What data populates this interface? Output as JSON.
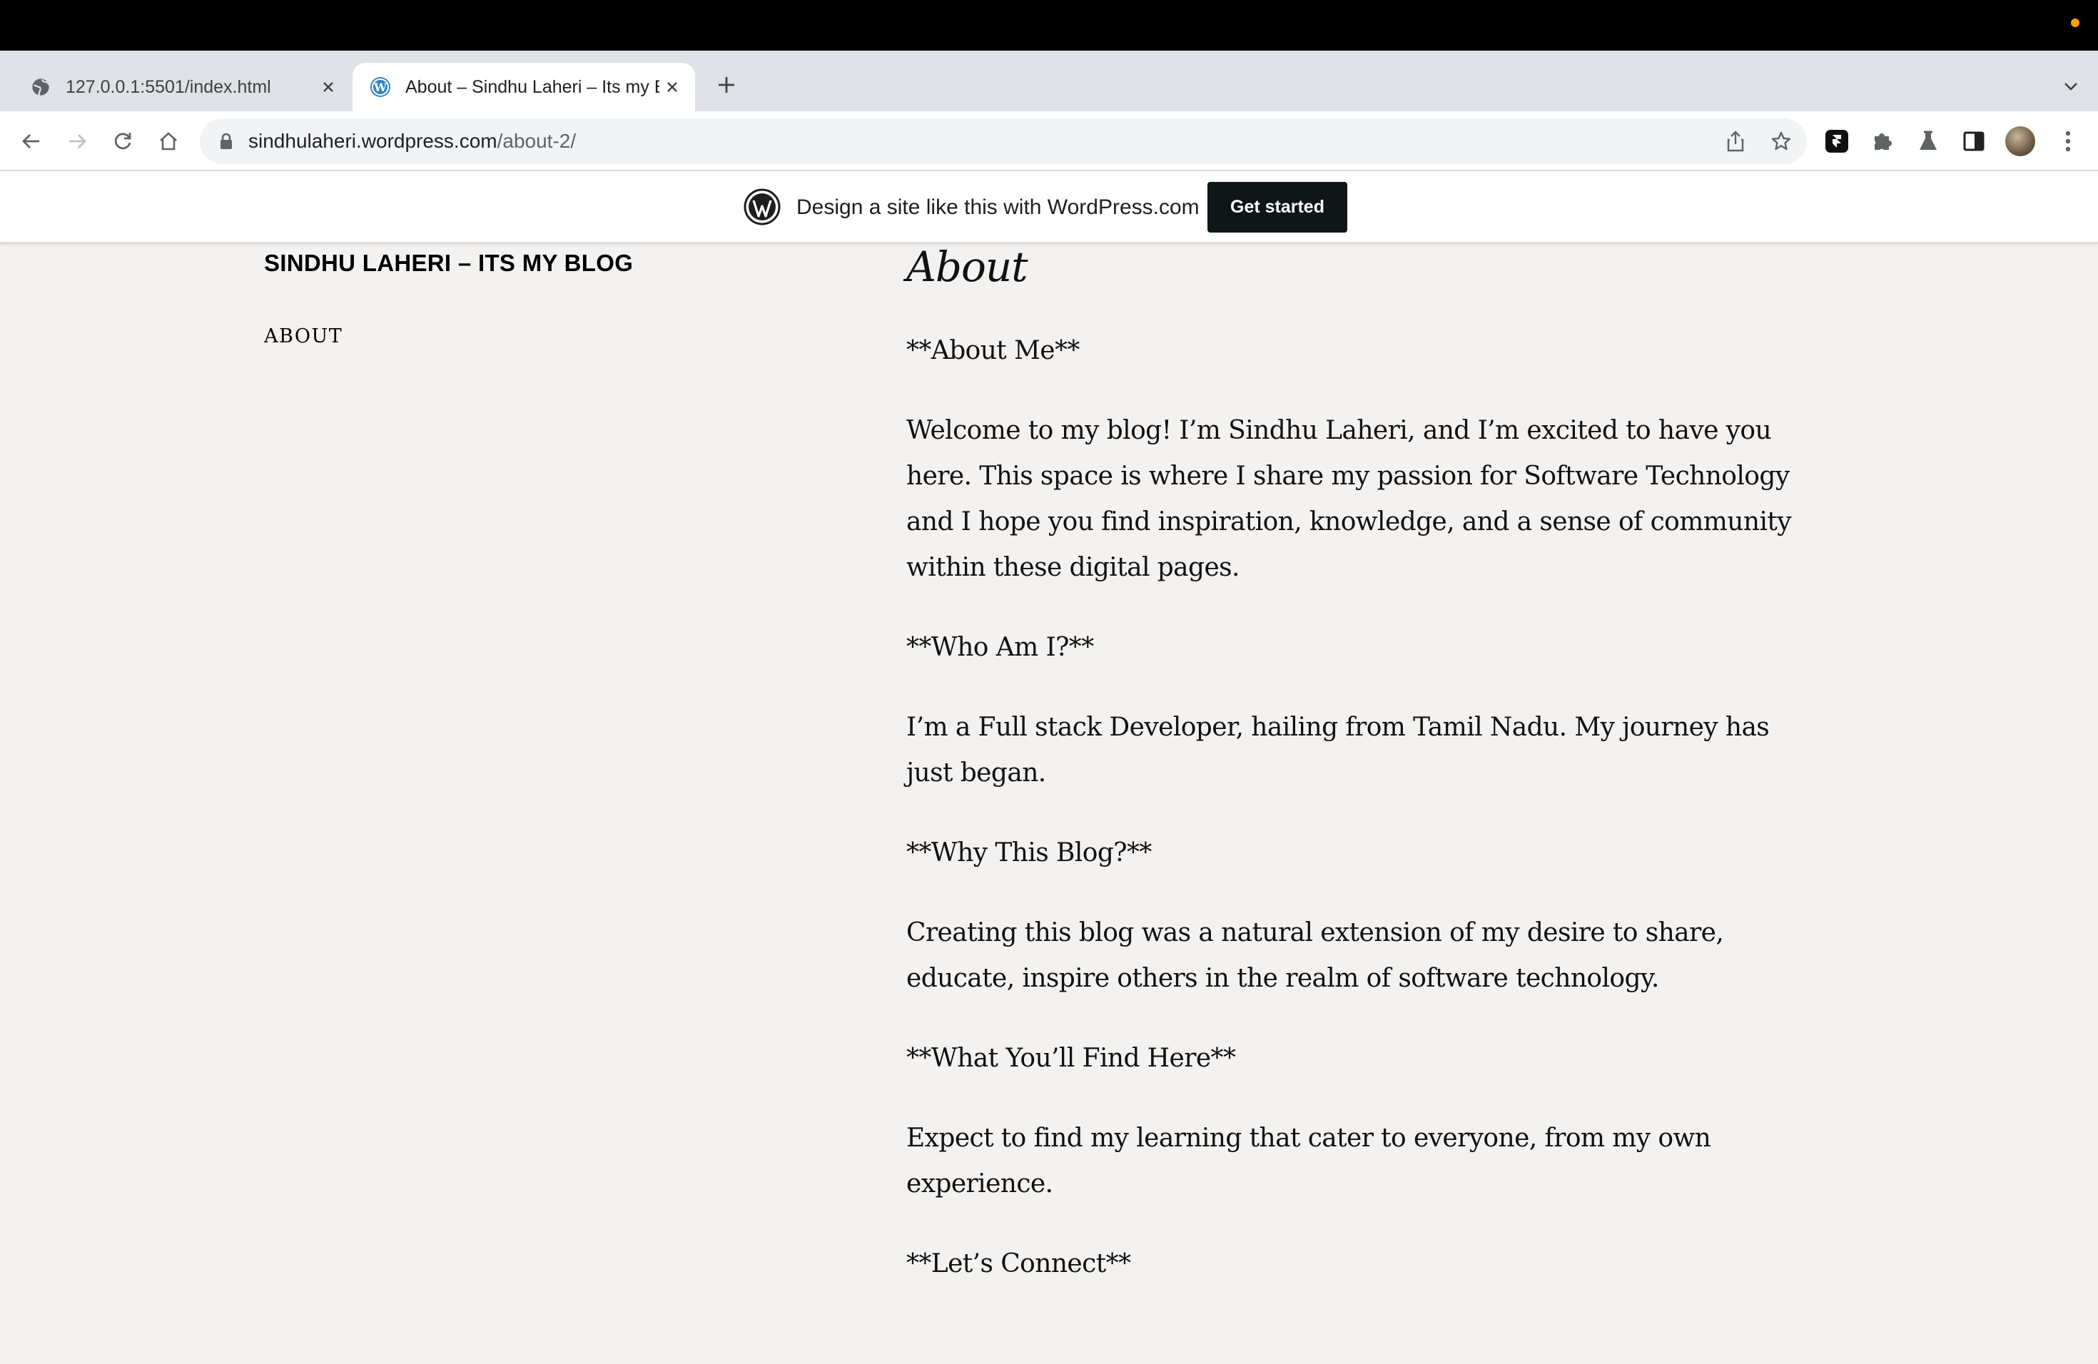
{
  "browser": {
    "tabs": [
      {
        "title": "127.0.0.1:5501/index.html",
        "favicon": "globe-icon",
        "active": false
      },
      {
        "title": "About – Sindhu Laheri – Its my Blog",
        "favicon": "wordpress-icon",
        "active": true
      }
    ],
    "url": {
      "host": "sindhulaheri.wordpress.com",
      "path": "/about-2/"
    }
  },
  "wp_banner": {
    "text": "Design a site like this with WordPress.com",
    "button": "Get started"
  },
  "site": {
    "title": "SINDHU LAHERI – ITS MY BLOG",
    "nav": [
      "ABOUT"
    ]
  },
  "page": {
    "title": "About",
    "paragraphs": [
      "**About Me**",
      "Welcome to my blog! I’m Sindhu Laheri, and I’m excited to have you here. This space is where I share my passion for Software Technology and I hope you find inspiration, knowledge, and a sense of community within these digital pages.",
      "**Who Am I?**",
      "I’m a Full stack Developer, hailing from Tamil Nadu. My journey has just began.",
      "**Why This Blog?**",
      "Creating this blog was a natural extension of my desire to share, educate, inspire others in the realm of software technology.",
      "**What You’ll Find Here**",
      "Expect to find my learning that cater to everyone, from my own experience.",
      "**Let’s Connect**"
    ]
  }
}
